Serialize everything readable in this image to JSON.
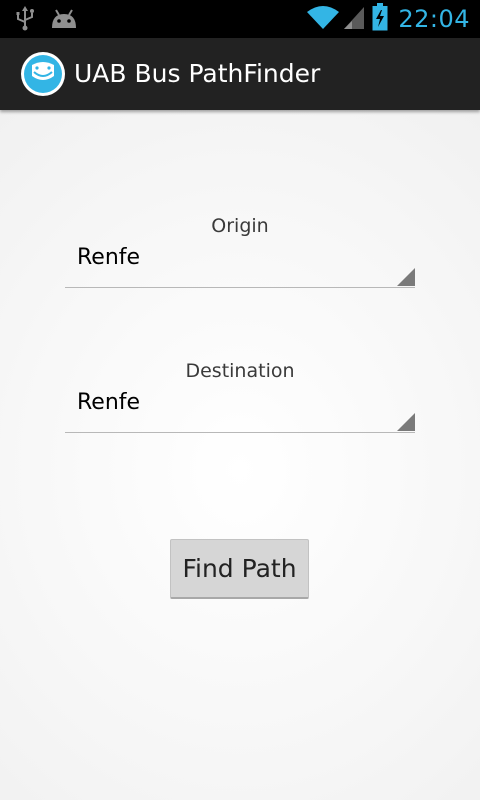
{
  "status_bar": {
    "time": "22:04",
    "icons": [
      "usb-icon",
      "android-debug-icon",
      "wifi-icon",
      "signal-icon",
      "battery-charging-icon"
    ]
  },
  "action_bar": {
    "title": "UAB Bus PathFinder",
    "app_icon": "app-logo-icon"
  },
  "form": {
    "origin_label": "Origin",
    "origin_value": "Renfe",
    "destination_label": "Destination",
    "destination_value": "Renfe",
    "submit_label": "Find Path"
  },
  "colors": {
    "accent": "#33b5e5",
    "action_bar": "#222222",
    "status_bar": "#000000"
  }
}
